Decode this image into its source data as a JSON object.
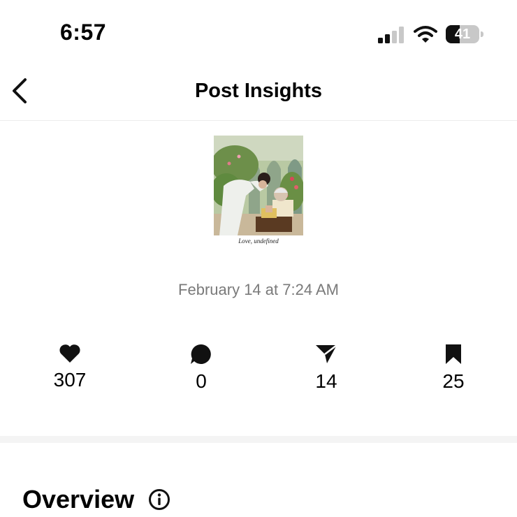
{
  "status_bar": {
    "time": "6:57",
    "battery": "41",
    "battery_level": 0.41
  },
  "nav": {
    "title": "Post Insights"
  },
  "post": {
    "caption": "Love, undefined",
    "date": "February 14 at 7:24 AM"
  },
  "stats": [
    {
      "icon": "heart-icon",
      "value": "307"
    },
    {
      "icon": "comment-icon",
      "value": "0"
    },
    {
      "icon": "share-icon",
      "value": "14"
    },
    {
      "icon": "bookmark-icon",
      "value": "25"
    }
  ],
  "overview": {
    "title": "Overview"
  }
}
